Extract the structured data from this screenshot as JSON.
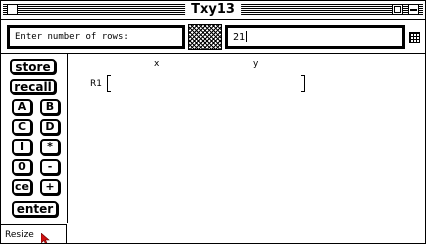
{
  "window": {
    "title": "Txy13"
  },
  "prompt": {
    "label": "Enter number of rows:",
    "value": "21"
  },
  "keypad": {
    "store": "store",
    "recall": "recall",
    "keys": [
      "A",
      "B",
      "C",
      "D",
      "I",
      "*",
      "0",
      "-",
      "ce",
      "+"
    ],
    "enter": "enter"
  },
  "matrix": {
    "columns": [
      "x",
      "y"
    ],
    "rows": [
      {
        "label": "R1"
      }
    ]
  },
  "status": {
    "resize_label": "Resize"
  }
}
